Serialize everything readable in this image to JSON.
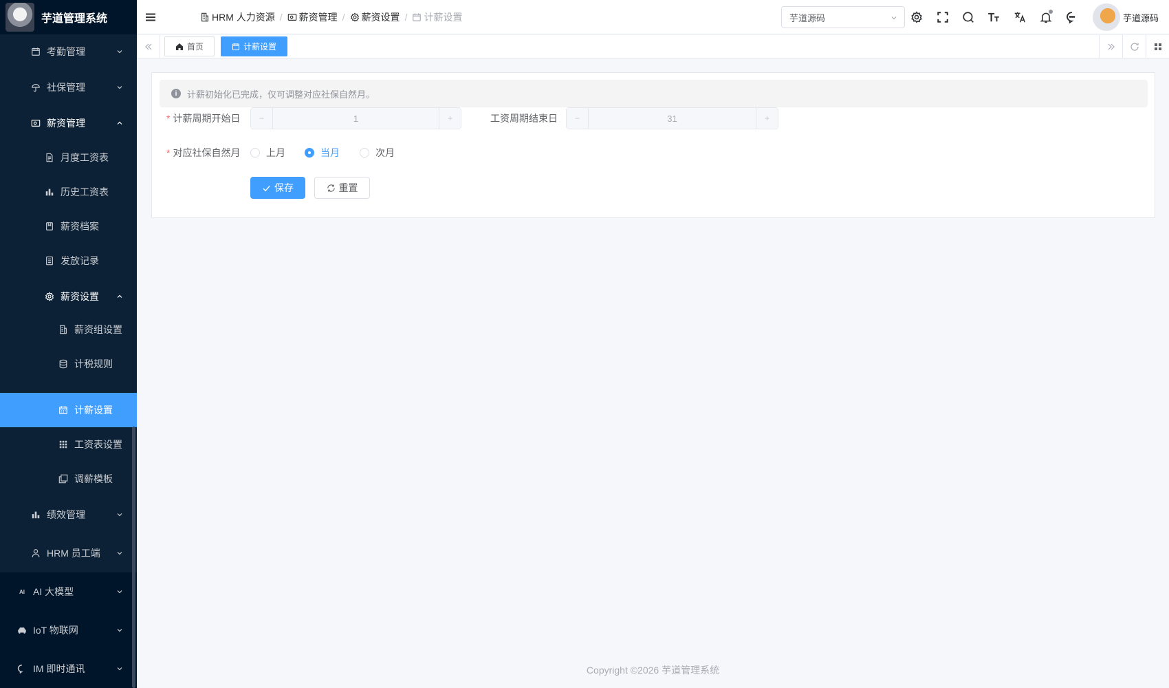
{
  "app": {
    "title": "芋道管理系统"
  },
  "sidebar": {
    "items": [
      {
        "label": "考勤管理",
        "icon": "calendar-icon",
        "expanded": false
      },
      {
        "label": "社保管理",
        "icon": "umbrella-icon",
        "expanded": false
      },
      {
        "label": "薪资管理",
        "icon": "wallet-icon",
        "expanded": true
      },
      {
        "label": "月度工资表",
        "icon": "document-icon"
      },
      {
        "label": "历史工资表",
        "icon": "bar-chart-icon"
      },
      {
        "label": "薪资档案",
        "icon": "archive-icon"
      },
      {
        "label": "发放记录",
        "icon": "record-icon"
      },
      {
        "label": "薪资设置",
        "icon": "gear-icon",
        "expanded": true
      },
      {
        "label": "薪资组设置",
        "icon": "building-icon"
      },
      {
        "label": "计税规则",
        "icon": "database-icon"
      },
      {
        "label": "计薪设置",
        "icon": "calendar-icon",
        "active": true
      },
      {
        "label": "工资表设置",
        "icon": "grid-icon"
      },
      {
        "label": "调薪模板",
        "icon": "copy-icon"
      },
      {
        "label": "绩效管理",
        "icon": "bar-chart-icon",
        "expanded": false
      },
      {
        "label": "HRM 员工端",
        "icon": "user-icon",
        "expanded": false
      },
      {
        "label": "AI 大模型",
        "icon": "ai-icon",
        "expanded": false
      },
      {
        "label": "IoT 物联网",
        "icon": "car-icon",
        "expanded": false
      },
      {
        "label": "IM 即时通讯",
        "icon": "chat-icon",
        "expanded": false
      }
    ]
  },
  "header": {
    "breadcrumb": [
      "HRM 人力资源",
      "薪资管理",
      "薪资设置",
      "计薪设置"
    ],
    "tenant": "芋道源码",
    "user_name": "芋道源码"
  },
  "tags": [
    {
      "label": "首页",
      "icon": "home-icon"
    },
    {
      "label": "计薪设置",
      "icon": "calendar-icon",
      "active": true
    }
  ],
  "form": {
    "alert": "计薪初始化已完成，仅可调整对应社保自然月。",
    "start_day_label": "计薪周期开始日",
    "start_day_value": "1",
    "end_day_label": "工资周期结束日",
    "end_day_value": "31",
    "month_label": "对应社保自然月",
    "month_options": [
      "上月",
      "当月",
      "次月"
    ],
    "month_selected": "当月",
    "decrement_symbol": "−",
    "increment_symbol": "+",
    "save_label": "保存",
    "reset_label": "重置"
  },
  "footer": {
    "copyright": "Copyright ©2026 芋道管理系统"
  },
  "colors": {
    "primary": "#409eff",
    "sidebar_bg": "#001529"
  }
}
